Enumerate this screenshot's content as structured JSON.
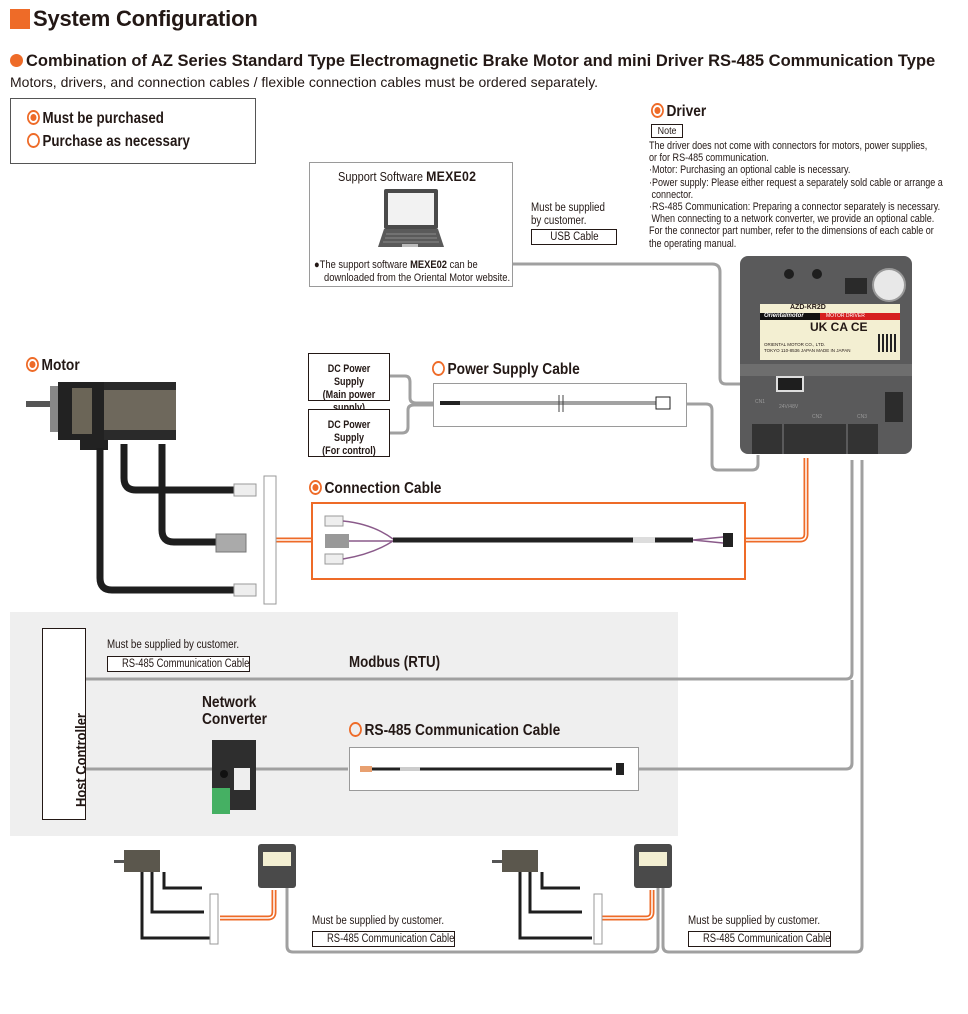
{
  "page": {
    "title": "System Configuration",
    "subtitle": "Combination of AZ Series Standard Type Electromagnetic Brake Motor and mini Driver RS-485 Communication Type",
    "note": "Motors, drivers, and connection cables / flexible connection cables must be ordered separately."
  },
  "legend": {
    "must": "Must be purchased",
    "optional": "Purchase as necessary"
  },
  "software": {
    "label": "Support Software",
    "name": "MEXE02",
    "desc_prefix": "The support software",
    "desc_name": "MEXE02",
    "desc_suffix": "can be",
    "desc_line2": "downloaded from the Oriental Motor website."
  },
  "usb": {
    "supplied_line1": "Must be supplied",
    "supplied_line2": "by customer.",
    "cable": "USB Cable"
  },
  "driver": {
    "title": "Driver",
    "note_tag": "Note",
    "notes": [
      "The driver does not come with connectors for motors, power supplies,",
      "or for RS-485 communication.",
      "·Motor: Purchasing an optional cable is necessary.",
      "·Power supply: Please either request a separately sold cable or arrange a",
      " connector.",
      "·RS-485 Communication: Preparing a connector separately is necessary.",
      " When connecting to a network converter, we provide an optional cable.",
      "For the connector part number, refer to the dimensions of each cable or",
      "the operating manual."
    ],
    "model": "AZD-KR2D",
    "brand": "Orientalmotor",
    "label_type": "MOTOR DRIVER",
    "cert": "UK CA CE",
    "maker1": "ORIENTAL MOTOR CO., LTD.",
    "maker2": "TOKYO 110-8536 JAPAN   MADE IN JAPAN",
    "cn1": "CN1",
    "cn2": "CN2",
    "cn3": "CN3",
    "voltage": "24V/48V"
  },
  "motor": {
    "title": "Motor"
  },
  "power": {
    "supply_main_l1": "DC Power Supply",
    "supply_main_l2": "(Main power supply)",
    "supply_ctrl_l1": "DC Power Supply",
    "supply_ctrl_l2": "(For control)",
    "cable_title": "Power Supply Cable"
  },
  "connection": {
    "title": "Connection Cable"
  },
  "network": {
    "host": "Host Controller",
    "supplied": "Must be supplied by customer.",
    "rs485_cable": "RS-485 Communication Cable",
    "modbus": "Modbus (RTU)",
    "converter_l1": "Network",
    "converter_l2": "Converter",
    "optional_cable": "RS-485 Communication Cable"
  },
  "daisy": [
    {
      "supplied": "Must be supplied by customer.",
      "cable": "RS-485 Communication Cable"
    },
    {
      "supplied": "Must be supplied by customer.",
      "cable": "RS-485 Communication Cable"
    }
  ],
  "colors": {
    "accent": "#ee6b28",
    "wire": "#a0a0a0",
    "panel": "#efefef"
  }
}
